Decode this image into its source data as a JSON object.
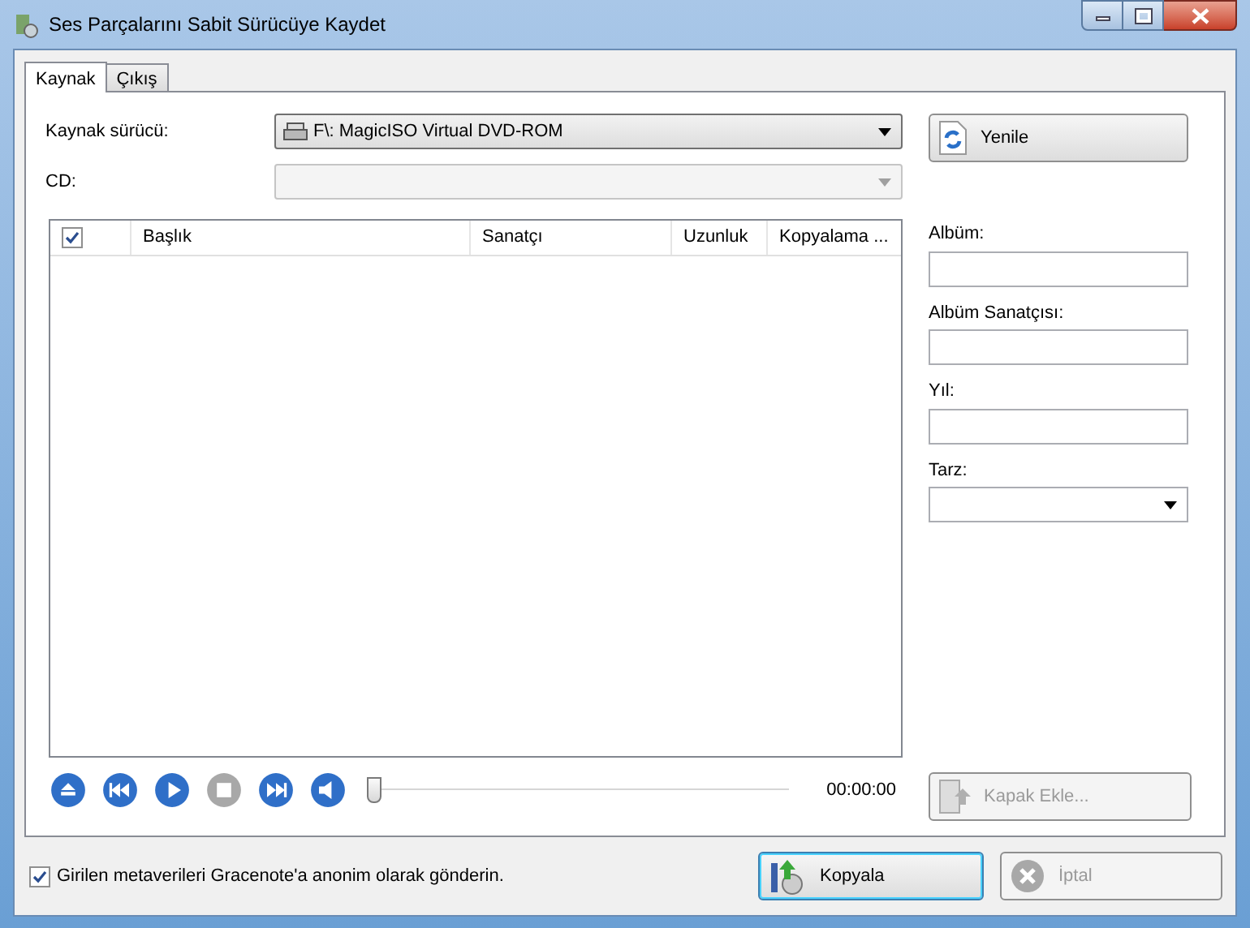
{
  "window": {
    "title": "Ses Parçalarını Sabit Sürücüye Kaydet"
  },
  "tabs": [
    {
      "label": "Kaynak",
      "selected": true
    },
    {
      "label": "Çıkış",
      "selected": false
    }
  ],
  "source_drive": {
    "label": "Kaynak sürücü:",
    "value": "F\\: MagicISO Virtual DVD-ROM"
  },
  "cd": {
    "label": "CD:",
    "disabled": true
  },
  "refresh_button": {
    "label": "Yenile",
    "disabled": false
  },
  "track_list": {
    "select_all_checked": true,
    "columns": [
      "Başlık",
      "Sanatçı",
      "Uzunluk",
      "Kopyalama ..."
    ]
  },
  "player": {
    "buttons": [
      {
        "kind": "eject",
        "disabled": false
      },
      {
        "kind": "previous",
        "disabled": false
      },
      {
        "kind": "play",
        "disabled": false
      },
      {
        "kind": "stop",
        "disabled": true
      },
      {
        "kind": "next",
        "disabled": false
      },
      {
        "kind": "volume",
        "disabled": false
      }
    ],
    "position": {
      "level": 0
    },
    "time": "00:00:00"
  },
  "album_fields": [
    {
      "label": "Albüm:",
      "kind": "text"
    },
    {
      "label": "Albüm Sanatçısı:",
      "kind": "text"
    },
    {
      "label": "Yıl:",
      "kind": "text"
    },
    {
      "label": "Tarz:",
      "kind": "dropdown"
    }
  ],
  "cover_button": {
    "label": "Kapak Ekle...",
    "disabled": true
  },
  "gracenote": {
    "label": "Girilen metaverileri Gracenote'a anonim olarak gönderin.",
    "checked": true
  },
  "buttons": [
    {
      "label": "Kopyala",
      "kind": "copy",
      "default": true,
      "disabled": false
    },
    {
      "label": "İptal",
      "kind": "cancel",
      "default": false,
      "disabled": true
    }
  ]
}
